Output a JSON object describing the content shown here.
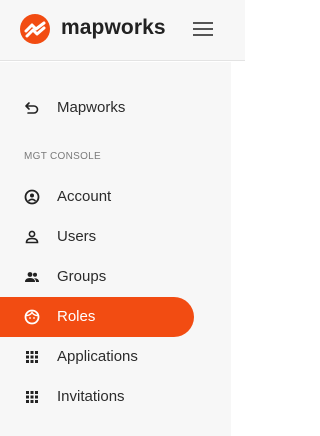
{
  "brand": {
    "name": "mapworks",
    "accent": "#f24c12"
  },
  "header": {
    "menu_icon": "hamburger-icon"
  },
  "back_link": {
    "label": "Mapworks",
    "icon": "back-arrow-icon"
  },
  "section": {
    "title": "MGT CONSOLE"
  },
  "nav": {
    "items": [
      {
        "label": "Account",
        "icon": "account-circle-icon",
        "active": false
      },
      {
        "label": "Users",
        "icon": "person-icon",
        "active": false
      },
      {
        "label": "Groups",
        "icon": "groups-icon",
        "active": false
      },
      {
        "label": "Roles",
        "icon": "face-icon",
        "active": true
      },
      {
        "label": "Applications",
        "icon": "apps-grid-icon",
        "active": false
      },
      {
        "label": "Invitations",
        "icon": "apps-grid-icon",
        "active": false
      }
    ]
  }
}
